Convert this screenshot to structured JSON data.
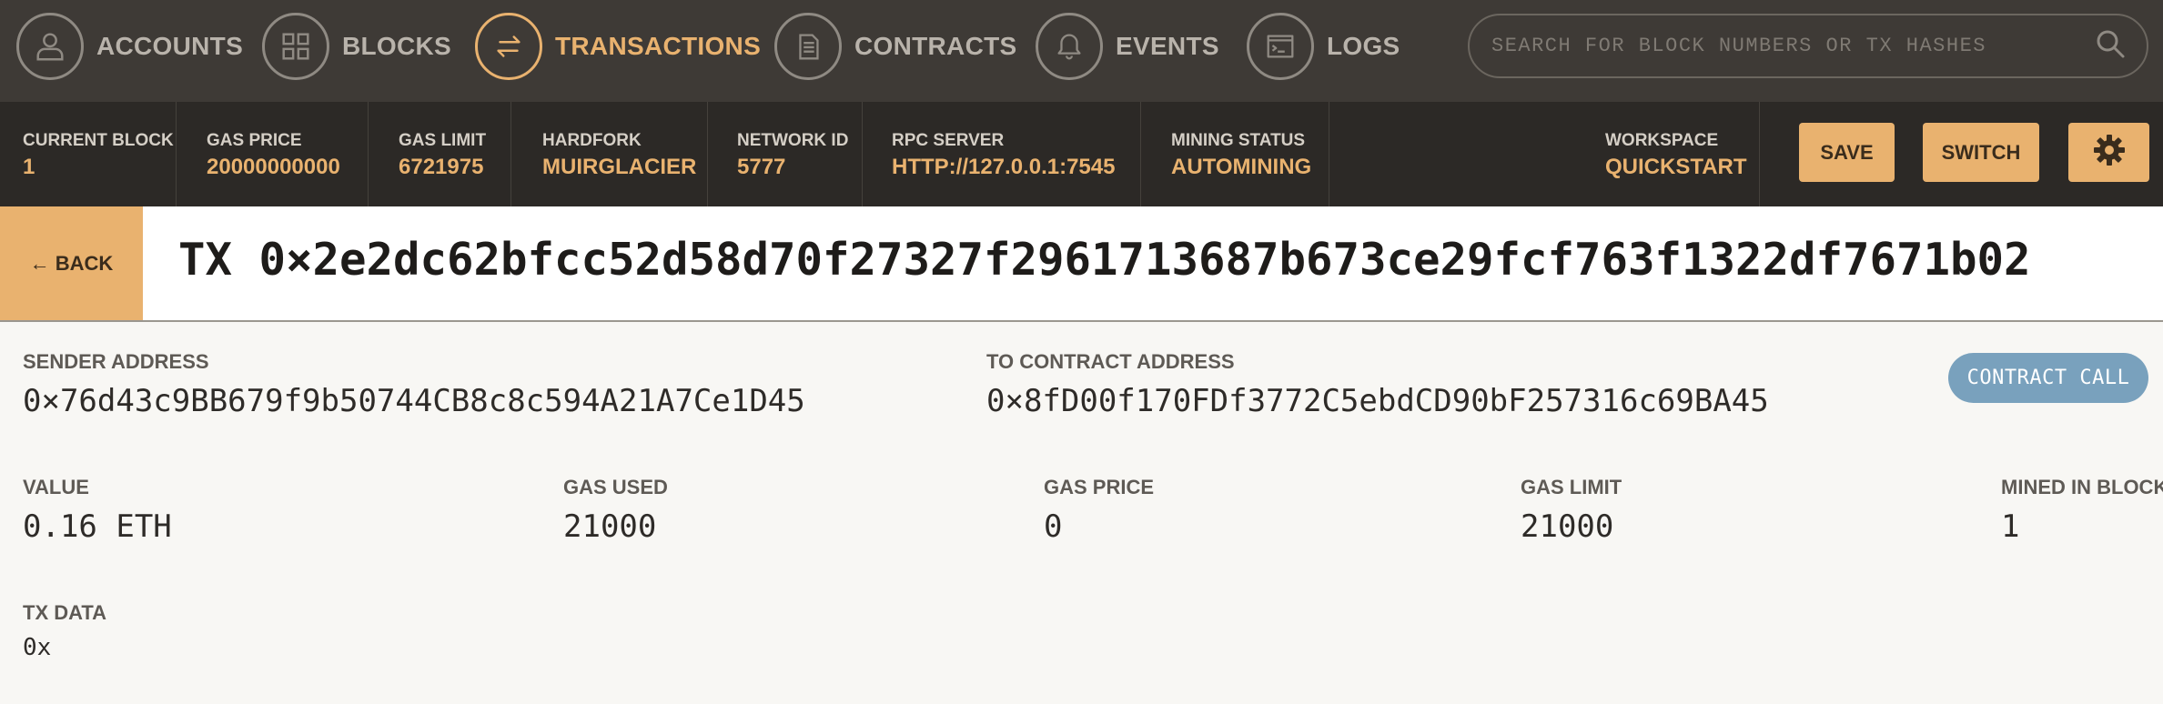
{
  "nav": {
    "items": [
      {
        "label": "ACCOUNTS",
        "icon": "person-icon"
      },
      {
        "label": "BLOCKS",
        "icon": "grid-icon"
      },
      {
        "label": "TRANSACTIONS",
        "icon": "arrows-swap-icon",
        "active": true
      },
      {
        "label": "CONTRACTS",
        "icon": "document-icon"
      },
      {
        "label": "EVENTS",
        "icon": "bell-icon"
      },
      {
        "label": "LOGS",
        "icon": "terminal-icon"
      }
    ],
    "search_placeholder": "SEARCH FOR BLOCK NUMBERS OR TX HASHES"
  },
  "status": {
    "current_block": {
      "label": "CURRENT BLOCK",
      "value": "1"
    },
    "gas_price": {
      "label": "GAS PRICE",
      "value": "20000000000"
    },
    "gas_limit": {
      "label": "GAS LIMIT",
      "value": "6721975"
    },
    "hardfork": {
      "label": "HARDFORK",
      "value": "MUIRGLACIER"
    },
    "network_id": {
      "label": "NETWORK ID",
      "value": "5777"
    },
    "rpc_server": {
      "label": "RPC SERVER",
      "value": "HTTP://127.0.0.1:7545"
    },
    "mining_status": {
      "label": "MINING STATUS",
      "value": "AUTOMINING"
    },
    "workspace": {
      "label": "WORKSPACE",
      "value": "QUICKSTART"
    },
    "save_label": "SAVE",
    "switch_label": "SWITCH",
    "settings_icon": "gear-icon"
  },
  "header": {
    "back_label": "← BACK",
    "title": "TX 0×2e2dc62bfcc52d58d70f27327f2961713687b673ce29fcf763f1322df7671b02"
  },
  "tx": {
    "sender": {
      "label": "SENDER ADDRESS",
      "value": "0×76d43c9BB679f9b50744CB8c8c594A21A7Ce1D45"
    },
    "to": {
      "label": "TO CONTRACT ADDRESS",
      "value": "0×8fD00f170FDf3772C5ebdCD90bF257316c69BA45"
    },
    "type_badge": "CONTRACT CALL",
    "value": {
      "label": "VALUE",
      "value": "0.16 ETH"
    },
    "gas_used": {
      "label": "GAS USED",
      "value": "21000"
    },
    "gas_price": {
      "label": "GAS PRICE",
      "value": "0"
    },
    "gas_limit": {
      "label": "GAS LIMIT",
      "value": "21000"
    },
    "mined_in_block": {
      "label": "MINED IN BLOCK",
      "value": "1"
    },
    "data": {
      "label": "TX DATA",
      "value": "0x"
    }
  },
  "colors": {
    "accent": "#e9b26f",
    "nav_bg": "#3e3a36",
    "status_bg": "#2c2926",
    "badge_bg": "#79a1bd"
  }
}
